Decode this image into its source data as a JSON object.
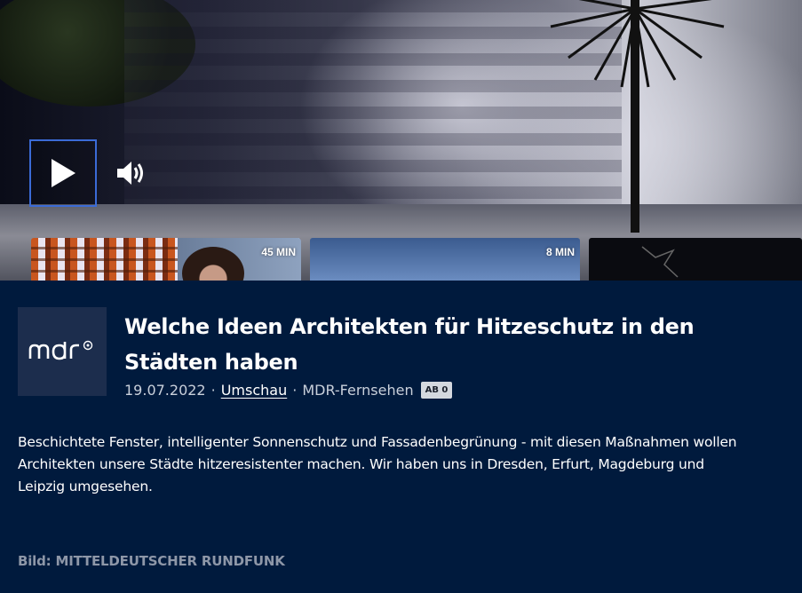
{
  "player": {
    "play_icon": "play-icon",
    "volume_icon": "volume-icon"
  },
  "teasers": [
    {
      "duration": "45 MIN"
    },
    {
      "duration": "8 MIN"
    },
    {
      "duration": ""
    }
  ],
  "article": {
    "logo_text": "mdr",
    "title": "Welche Ideen Architekten für Hitzeschutz in den Städten haben",
    "date": "19.07.2022",
    "separator": "·",
    "show_link": "Umschau",
    "channel": "MDR-Fernsehen",
    "age_badge": "AB 0",
    "description": "Beschichtete Fenster, intelligenter Sonnenschutz und Fassadenbegrünung - mit diesen Maßnahmen wollen Architekten unsere Städte hitzeresistenter machen. Wir haben uns in Dresden, Erfurt, Magdeburg und Leipzig umgesehen.",
    "credit": "Bild: MITTELDEUTSCHER RUNDFUNK"
  },
  "colors": {
    "background": "#001a3d",
    "logo_bg": "#1c2d4d",
    "focus_border": "#3b6bd6"
  }
}
